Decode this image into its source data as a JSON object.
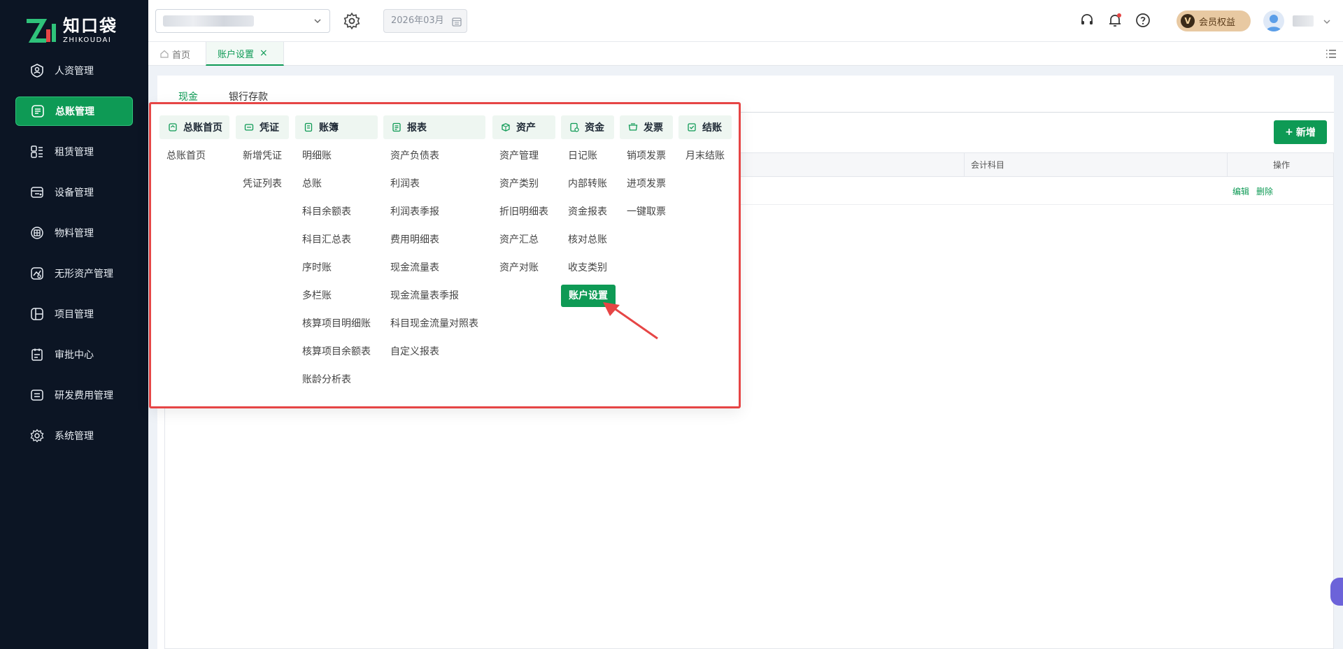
{
  "brand": {
    "name_cn": "知口袋",
    "name_en": "ZHIKOUDAI"
  },
  "sidebar": {
    "items": [
      {
        "label": "人资管理",
        "icon": "person-badge-icon",
        "active": false
      },
      {
        "label": "总账管理",
        "icon": "ledger-icon",
        "active": true
      },
      {
        "label": "租赁管理",
        "icon": "lease-icon",
        "active": false
      },
      {
        "label": "设备管理",
        "icon": "device-icon",
        "active": false
      },
      {
        "label": "物料管理",
        "icon": "material-icon",
        "active": false
      },
      {
        "label": "无形资产管理",
        "icon": "intangible-asset-icon",
        "active": false
      },
      {
        "label": "项目管理",
        "icon": "project-icon",
        "active": false
      },
      {
        "label": "审批中心",
        "icon": "approval-icon",
        "active": false
      },
      {
        "label": "研发费用管理",
        "icon": "rnd-expense-icon",
        "active": false
      },
      {
        "label": "系统管理",
        "icon": "settings-icon",
        "active": false
      }
    ]
  },
  "topbar": {
    "date": "2026年03月",
    "vip_label": "会员权益",
    "vip_badge": "V"
  },
  "tabs": {
    "home": "首页",
    "active": "账户设置",
    "close": "×"
  },
  "content": {
    "sub_tabs": [
      "现金",
      "银行存款"
    ],
    "add_button": "新增",
    "add_icon": "+",
    "table": {
      "headers": [
        "会计科目",
        "操作"
      ],
      "row": {
        "edit": "编辑",
        "delete": "删除"
      }
    }
  },
  "mega_menu": {
    "columns": [
      {
        "title": "总账首页",
        "icon": "home-book-icon",
        "items": [
          "总账首页"
        ]
      },
      {
        "title": "凭证",
        "icon": "voucher-icon",
        "items": [
          "新增凭证",
          "凭证列表"
        ]
      },
      {
        "title": "账簿",
        "icon": "ledger-book-icon",
        "items": [
          "明细账",
          "总账",
          "科目余额表",
          "科目汇总表",
          "序时账",
          "多栏账",
          "核算项目明细账",
          "核算项目余额表",
          "账龄分析表"
        ]
      },
      {
        "title": "报表",
        "icon": "report-icon",
        "items": [
          "资产负债表",
          "利润表",
          "利润表季报",
          "费用明细表",
          "现金流量表",
          "现金流量表季报",
          "科目现金流量对照表",
          "自定义报表"
        ]
      },
      {
        "title": "资产",
        "icon": "asset-icon",
        "items": [
          "资产管理",
          "资产类别",
          "折旧明细表",
          "资产汇总",
          "资产对账"
        ]
      },
      {
        "title": "资金",
        "icon": "fund-icon",
        "items": [
          "日记账",
          "内部转账",
          "资金报表",
          "核对总账",
          "收支类别",
          "账户设置"
        ]
      },
      {
        "title": "发票",
        "icon": "invoice-icon",
        "items": [
          "销项发票",
          "进项发票",
          "一键取票"
        ]
      },
      {
        "title": "结账",
        "icon": "closing-icon",
        "items": [
          "月末结账"
        ]
      }
    ],
    "selected": "账户设置"
  },
  "colors": {
    "accent": "#0e9a55",
    "sidebar_bg": "#0c1524",
    "highlight_border": "#e64545"
  }
}
